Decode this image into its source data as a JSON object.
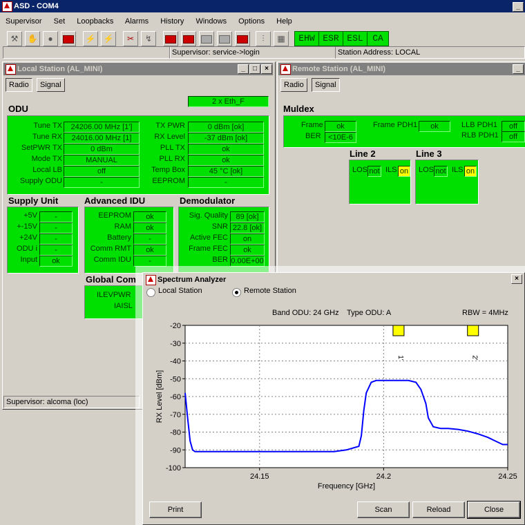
{
  "app": {
    "title": "ASD - COM4",
    "menu": [
      "Supervisor",
      "Set",
      "Loopbacks",
      "Alarms",
      "History",
      "Windows",
      "Options",
      "Help"
    ],
    "toolbar_status": [
      "EHW",
      "ESR",
      "ESL",
      "CA"
    ],
    "status_supervisor": "Supervisor: service->login",
    "status_station": "Station Address: LOCAL",
    "colors": {
      "panel_green": "#00e000",
      "title_active": "#0a246a",
      "title_inactive": "#808080",
      "highlight_yellow": "#ffff00",
      "trace_blue": "#0000ff"
    }
  },
  "local": {
    "title": "Local Station (AL_MINI)",
    "tabs": [
      "Radio",
      "Signal"
    ],
    "eth": "2 x Eth_F",
    "odu_title": "ODU",
    "odu_left": [
      {
        "label": "Tune TX",
        "value": "24206.00 MHz  [1']"
      },
      {
        "label": "Tune RX",
        "value": "24016.00 MHz  [1]"
      },
      {
        "label": "SetPWR TX",
        "value": "0 dBm"
      },
      {
        "label": "Mode TX",
        "value": "MANUAL"
      },
      {
        "label": "Local LB",
        "value": "off"
      },
      {
        "label": "Supply ODU",
        "value": "-"
      }
    ],
    "odu_right": [
      {
        "label": "TX PWR",
        "value": "0 dBm [ok]"
      },
      {
        "label": "RX Level",
        "value": "-37 dBm [ok]"
      },
      {
        "label": "PLL TX",
        "value": "ok"
      },
      {
        "label": "PLL RX",
        "value": "ok"
      },
      {
        "label": "Temp Box",
        "value": "45 °C [ok]"
      },
      {
        "label": "EEPROM",
        "value": "-"
      }
    ],
    "supply_title": "Supply Unit",
    "supply": [
      {
        "label": "+5V",
        "value": "-"
      },
      {
        "label": "+-15V",
        "value": "-"
      },
      {
        "label": "+24V",
        "value": "-"
      },
      {
        "label": "ODU  i",
        "value": "-"
      },
      {
        "label": "Input",
        "value": "ok"
      }
    ],
    "idu_title": "Advanced IDU",
    "idu": [
      {
        "label": "EEPROM",
        "value": "ok"
      },
      {
        "label": "RAM",
        "value": "ok"
      },
      {
        "label": "Battery",
        "value": "-"
      },
      {
        "label": "Comm RMT",
        "value": "ok"
      },
      {
        "label": "Comm IDU",
        "value": "-"
      }
    ],
    "demod_title": "Demodulator",
    "demod": [
      {
        "label": "Sig. Quality",
        "value": "89 [ok]"
      },
      {
        "label": "SNR",
        "value": "22.8 [ok]"
      },
      {
        "label": "Active FEC",
        "value": "on"
      },
      {
        "label": "Frame FEC",
        "value": "ok"
      },
      {
        "label": "BER",
        "value": "0.00E+00"
      }
    ],
    "global_title": "Global Com",
    "global_labels": [
      "ILEVPWR",
      "IAISL"
    ],
    "statusbar": "Supervisor: alcoma (loc)"
  },
  "remote": {
    "title": "Remote Station (AL_MINI)",
    "tabs": [
      "Radio",
      "Signal"
    ],
    "muldex_title": "Muldex",
    "frame_label": "Frame",
    "frame_value": "ok",
    "ber_label": "BER",
    "ber_value": "<10E-6",
    "frame_pdh_label": "Frame PDH1",
    "frame_pdh_value": "ok",
    "llb_label": "LLB PDH1",
    "llb_value": "off",
    "rlb_label": "RLB PDH1",
    "rlb_value": "off",
    "line2_title": "Line 2",
    "line3_title": "Line 3",
    "los_label": "LOS",
    "los_value": "not",
    "ils_label": "ILS",
    "ils_value": "on"
  },
  "spectrum": {
    "title": "Spectrum Analyzer",
    "radio_local": "Local Station",
    "radio_remote": "Remote Station",
    "selected": "remote",
    "band": "Band ODU: 24 GHz",
    "type": "Type ODU: A",
    "rbw": "RBW = 4MHz",
    "buttons": {
      "print": "Print",
      "scan": "Scan",
      "reload": "Reload",
      "close": "Close"
    },
    "markers": [
      {
        "x": 24.206,
        "label": "1'"
      },
      {
        "x": 24.236,
        "label": "2'"
      }
    ]
  },
  "chart_data": {
    "type": "line",
    "xlabel": "Frequency [GHz]",
    "ylabel": "RX Level [dBm]",
    "xlim": [
      24.12,
      24.25
    ],
    "ylim": [
      -100,
      -20
    ],
    "x_ticks": [
      24.15,
      24.2,
      24.25
    ],
    "y_ticks": [
      -20,
      -30,
      -40,
      -50,
      -60,
      -70,
      -80,
      -90,
      -100
    ],
    "grid": true,
    "series": [
      {
        "x": [
          24.12,
          24.121,
          24.122,
          24.123,
          24.124,
          24.13,
          24.15,
          24.17,
          24.18,
          24.185,
          24.19,
          24.191,
          24.192,
          24.193,
          24.195,
          24.197,
          24.2,
          24.205,
          24.21,
          24.213,
          24.215,
          24.217,
          24.218,
          24.22,
          24.223,
          24.226,
          24.23,
          24.234,
          24.238,
          24.242,
          24.245,
          24.248,
          24.25
        ],
        "y": [
          -58,
          -72,
          -85,
          -90,
          -91,
          -91,
          -91,
          -91,
          -91,
          -90,
          -88,
          -82,
          -68,
          -58,
          -52,
          -51,
          -51,
          -51,
          -51,
          -52,
          -56,
          -64,
          -72,
          -77,
          -78,
          -78,
          -78.5,
          -79.5,
          -81,
          -83,
          -85,
          -87,
          -87
        ]
      }
    ]
  }
}
